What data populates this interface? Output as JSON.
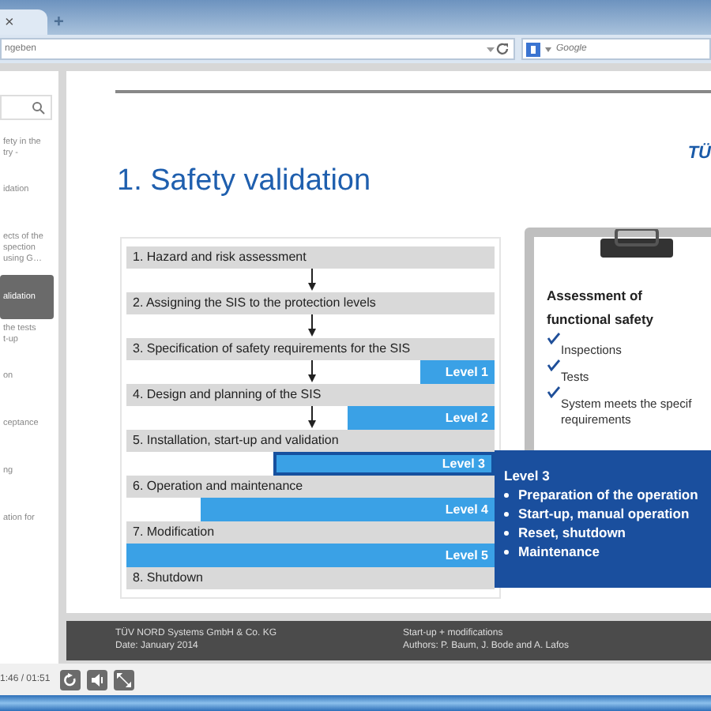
{
  "browser": {
    "tab_close": "×",
    "new_tab": "+",
    "address_placeholder": "ngeben",
    "search_placeholder": "Google"
  },
  "sidebar": {
    "items": [
      {
        "lines": [
          "fety in the",
          "try -"
        ],
        "selected": false
      },
      {
        "lines": [
          "idation"
        ],
        "selected": false
      },
      {
        "lines": [
          "ects of the",
          "spection",
          "using G…"
        ],
        "selected": false
      },
      {
        "lines": [
          "alidation"
        ],
        "selected": true
      },
      {
        "lines": [
          "the tests",
          "t-up"
        ],
        "selected": false
      },
      {
        "lines": [
          "on"
        ],
        "selected": false
      },
      {
        "lines": [
          "ceptance"
        ],
        "selected": false
      },
      {
        "lines": [
          "ng"
        ],
        "selected": false
      },
      {
        "lines": [
          "ation for"
        ],
        "selected": false
      }
    ]
  },
  "slide": {
    "logo": "TÜ",
    "title": "1. Safety validation",
    "steps": [
      {
        "label": "1. Hazard and risk assessment",
        "connector": {
          "arrow": true
        }
      },
      {
        "label": "2. Assigning the SIS to the protection levels",
        "connector": {
          "arrow": true
        }
      },
      {
        "label": "3. Specification of safety requirements for the SIS",
        "connector": {
          "arrow": true,
          "level_bar": {
            "label": "Level 1",
            "level": 0.2,
            "selected": false
          }
        }
      },
      {
        "label": "4. Design and planning of the SIS",
        "connector": {
          "arrow": true,
          "level_bar": {
            "label": "Level 2",
            "level": 0.4,
            "selected": false
          }
        }
      },
      {
        "label": "5. Installation, start-up and validation",
        "connector": {
          "arrow": false,
          "level_bar": {
            "label": "Level 3",
            "level": 0.6,
            "selected": true
          }
        }
      },
      {
        "label": "6. Operation and maintenance",
        "connector": {
          "arrow": false,
          "level_bar": {
            "label": "Level 4",
            "level": 0.8,
            "selected": false
          }
        }
      },
      {
        "label": "7. Modification",
        "connector": {
          "arrow": false,
          "level_bar": {
            "label": "Level 5",
            "level": 1.0,
            "selected": false
          }
        }
      },
      {
        "label": "8. Shutdown"
      }
    ],
    "clipboard": {
      "heading_lines": [
        "Assessment of",
        "functional safety"
      ],
      "items": [
        {
          "lines": [
            "Inspections"
          ],
          "checked": true
        },
        {
          "lines": [
            "Tests"
          ],
          "checked": true
        },
        {
          "lines": [
            "System meets the specif",
            "requirements"
          ],
          "checked": true
        }
      ]
    },
    "popup": {
      "title": "Level 3",
      "bullets": [
        "Preparation of the operation",
        "Start-up, manual operation",
        "Reset, shutdown",
        "Maintenance"
      ]
    },
    "footer": {
      "left": [
        "TÜV NORD Systems GmbH & Co. KG",
        "Date: January 2014"
      ],
      "right": [
        "Start-up + modifications",
        "Authors: P. Baum, J. Bode and A. Lafos"
      ]
    }
  },
  "player": {
    "time": "1:46 / 01:51"
  }
}
